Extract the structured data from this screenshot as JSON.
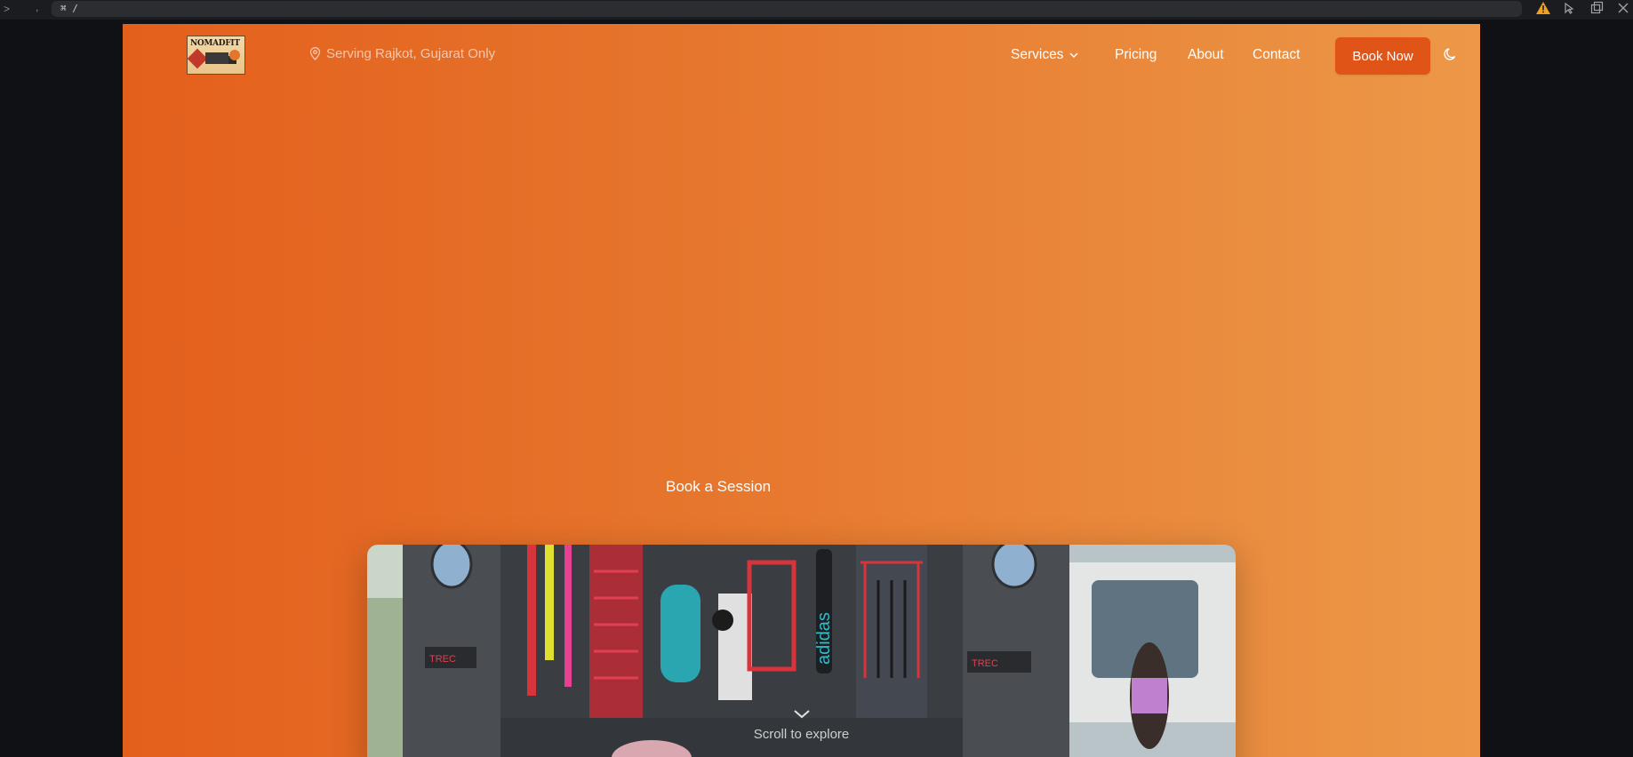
{
  "devbar": {
    "chevron": ">",
    "comma": ",",
    "url": "⌘ /"
  },
  "header": {
    "logo_text": "NOMADFIT",
    "location": "Serving Rajkot, Gujarat Only",
    "nav": {
      "services": "Services",
      "pricing": "Pricing",
      "about": "About",
      "contact": "Contact"
    },
    "book_now": "Book Now"
  },
  "hero": {
    "cta": "Book a Session",
    "scroll_label": "Scroll to explore",
    "image_signs": [
      "TREC",
      "TREC"
    ],
    "image_vertical_text": "adidas"
  },
  "colors": {
    "gradient_start": "#e35f1c",
    "gradient_end": "#ec9848",
    "button": "#e15418",
    "warning": "#f0a020"
  },
  "icons": {
    "location": "map-pin-icon",
    "services_toggle": "chevron-down-icon",
    "theme": "moon-icon",
    "scroll": "chevron-down-icon",
    "warning": "warning-icon"
  }
}
